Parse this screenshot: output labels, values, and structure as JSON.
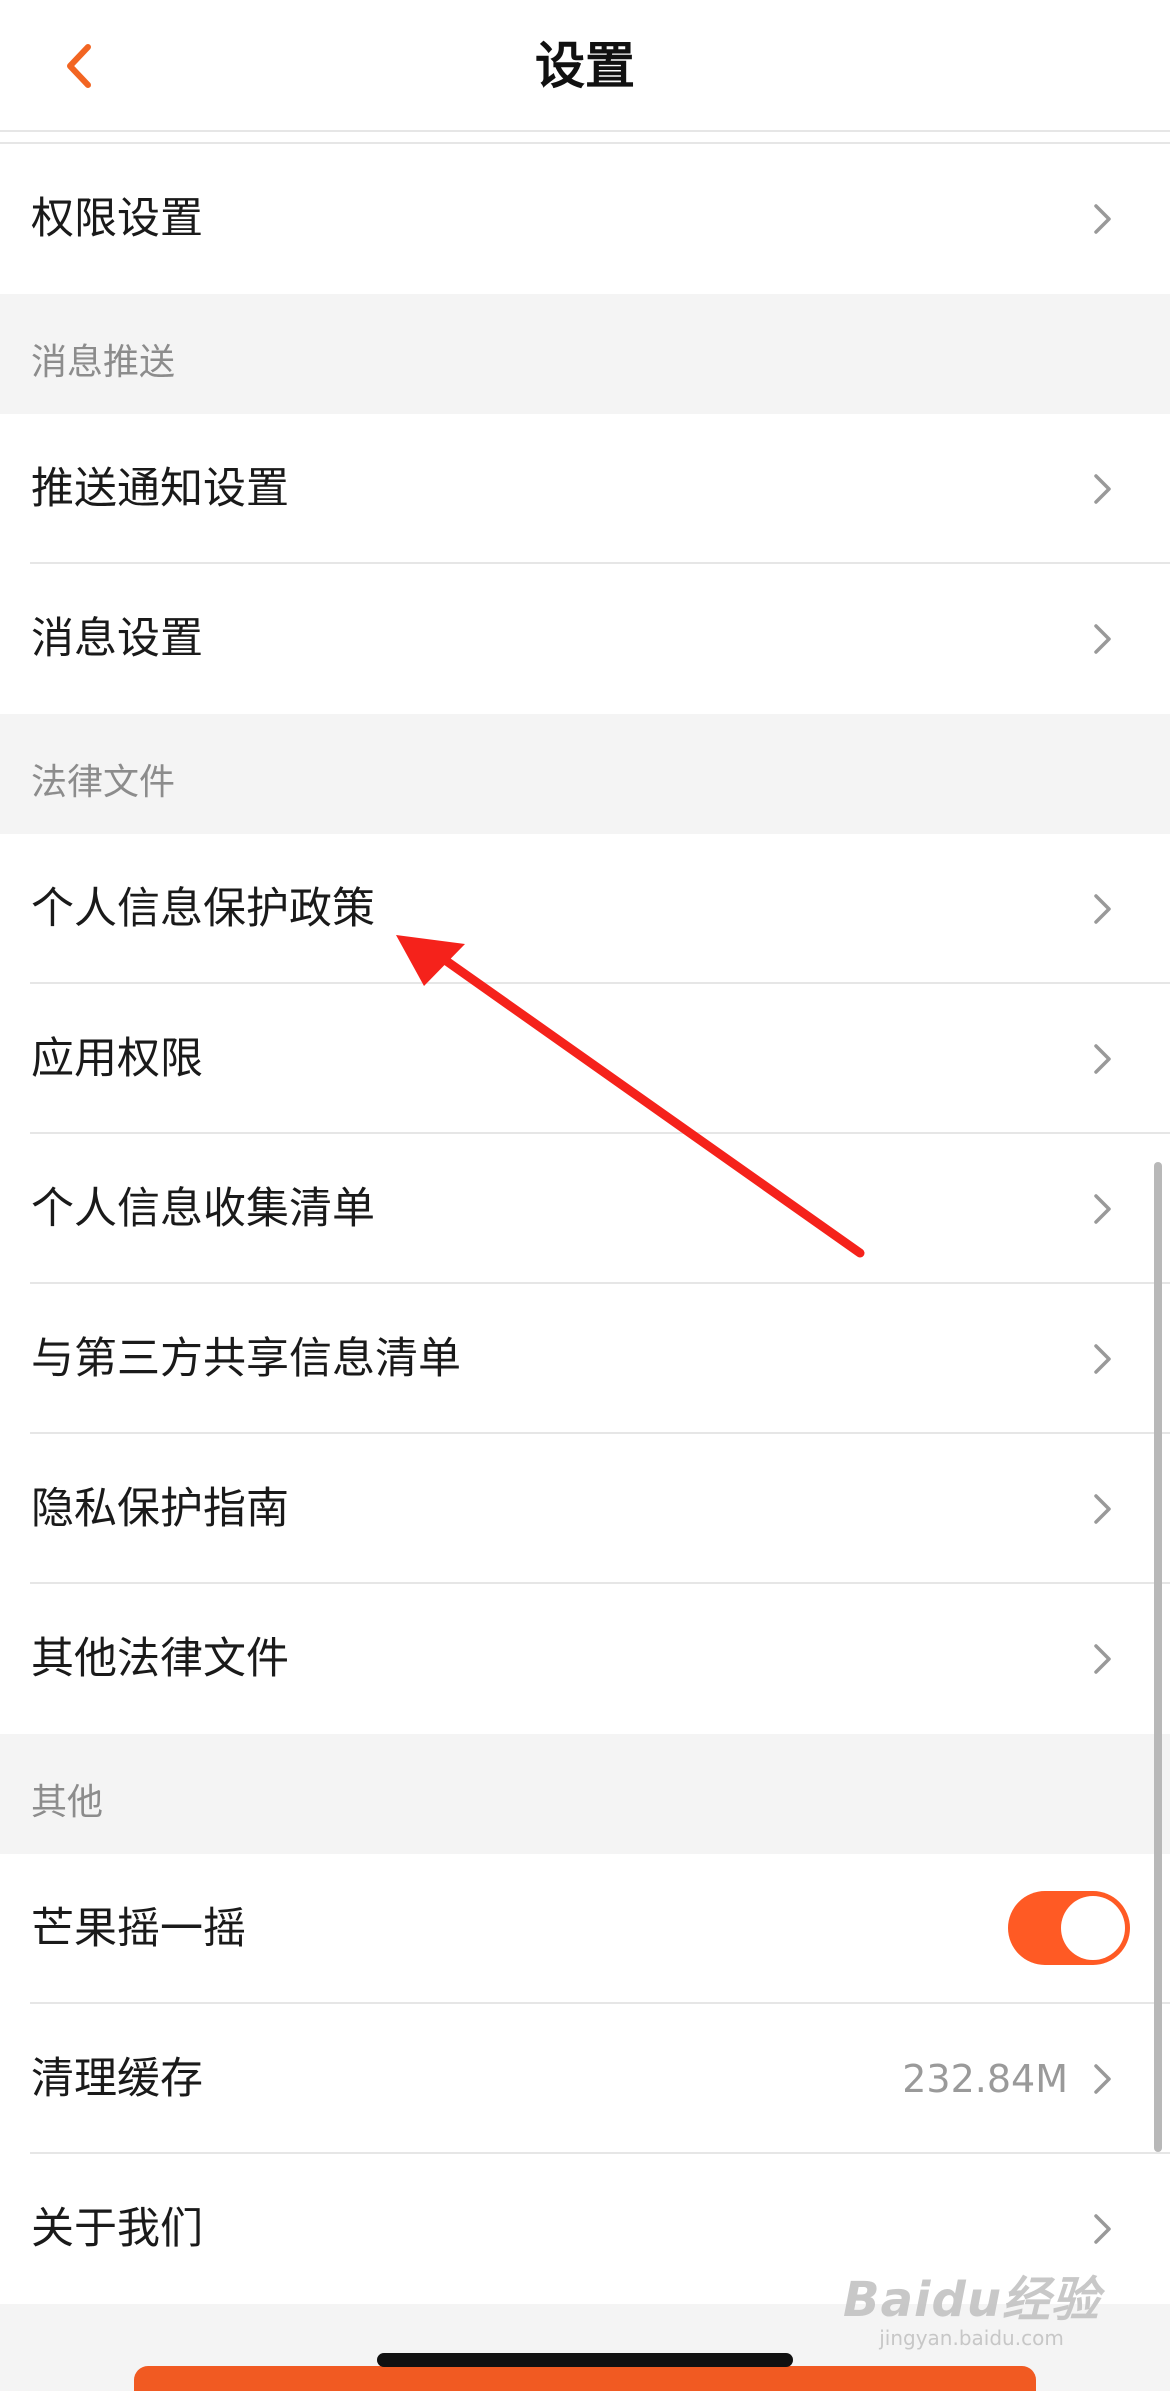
{
  "header": {
    "title": "设置",
    "back_icon": "chevron-left-icon",
    "accent_color": "#f26522"
  },
  "items_top": [
    {
      "label": "权限设置"
    }
  ],
  "sections": [
    {
      "title": "消息推送",
      "items": [
        {
          "label": "推送通知设置"
        },
        {
          "label": "消息设置"
        }
      ]
    },
    {
      "title": "法律文件",
      "items": [
        {
          "label": "个人信息保护政策"
        },
        {
          "label": "应用权限"
        },
        {
          "label": "个人信息收集清单"
        },
        {
          "label": "与第三方共享信息清单"
        },
        {
          "label": "隐私保护指南"
        },
        {
          "label": "其他法律文件"
        }
      ]
    },
    {
      "title": "其他",
      "items": [
        {
          "label": "芒果摇一摇",
          "toggle": true,
          "toggle_on": true
        },
        {
          "label": "清理缓存",
          "value": "232.84M"
        },
        {
          "label": "关于我们"
        }
      ]
    }
  ],
  "colors": {
    "toggle_on": "#ff5a24",
    "annotation_arrow": "#f5221b"
  },
  "watermark": {
    "main": "Baidu经验",
    "sub": "jingyan.baidu.com"
  }
}
